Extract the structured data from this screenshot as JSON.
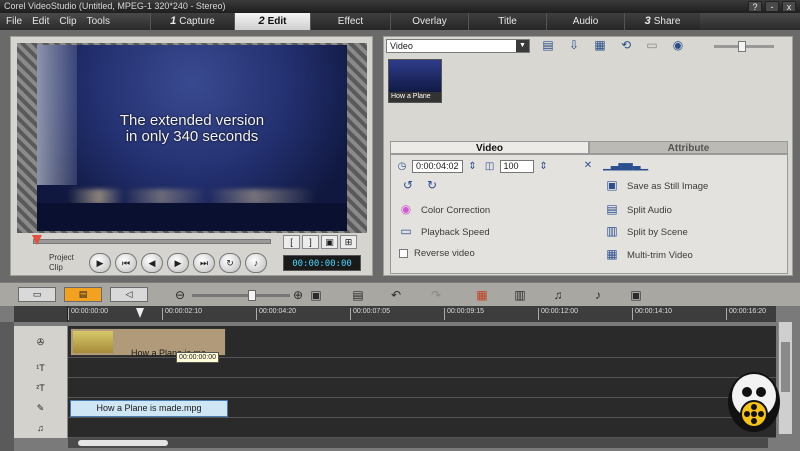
{
  "window": {
    "title": "Corel VideoStudio (Untitled, MPEG-1 320*240 - Stereo)",
    "help": "?",
    "minimize": "-",
    "close": "x"
  },
  "menus": [
    "File",
    "Edit",
    "Clip",
    "Tools"
  ],
  "steps": [
    {
      "num": "1",
      "label": "Capture",
      "active": false
    },
    {
      "num": "2",
      "label": "Edit",
      "active": true
    },
    {
      "num": "",
      "label": "Effect",
      "active": false
    },
    {
      "num": "",
      "label": "Overlay",
      "active": false
    },
    {
      "num": "",
      "label": "Title",
      "active": false
    },
    {
      "num": "",
      "label": "Audio",
      "active": false
    },
    {
      "num": "3",
      "label": "Share",
      "active": false
    }
  ],
  "preview": {
    "caption_line1": "The extended version",
    "caption_line2": "in only 340 seconds",
    "mode_project": "Project",
    "mode_clip": "Clip",
    "timecode": "00:00:00:00",
    "trim_start": "[",
    "trim_end": "]",
    "transport": [
      "play-icon",
      "home-icon",
      "prev-frame-icon",
      "next-frame-icon",
      "end-icon",
      "repeat-icon",
      "volume-icon"
    ]
  },
  "library": {
    "dropdown": "Video",
    "thumbnail_label": "How a Plane",
    "tabs": [
      "Video",
      "Attribute"
    ],
    "duration": "0:00:04:02",
    "volume": "100",
    "options": {
      "color_correction": "Color Correction",
      "playback_speed": "Playback Speed",
      "reverse_video": "Reverse video",
      "save_still": "Save as Still Image",
      "split_audio": "Split Audio",
      "split_scene": "Split by Scene",
      "multi_trim": "Multi-trim Video"
    }
  },
  "timeline": {
    "ticks": [
      "00:00:00:00",
      "00:00:02:10",
      "00:00:04:20",
      "00:00:07:05",
      "00:00:09:15",
      "00:00:12:00",
      "00:00:14:10",
      "00:00:16:20"
    ],
    "tracks": [
      "video-track",
      "title-track-1",
      "title-track-2",
      "voice-track",
      "music-track"
    ],
    "title_track_1_label": "¹T",
    "title_track_2_label": "²T",
    "video_clip_name": "How a Plane is ma",
    "video_clip_tip": "00:00:00:00",
    "music_clip_name": "How a Plane is made.mpg"
  },
  "colors": {
    "accent": "#f2a120",
    "timecode": "#4ad6ff",
    "music_clip": "#cfe6f5"
  }
}
